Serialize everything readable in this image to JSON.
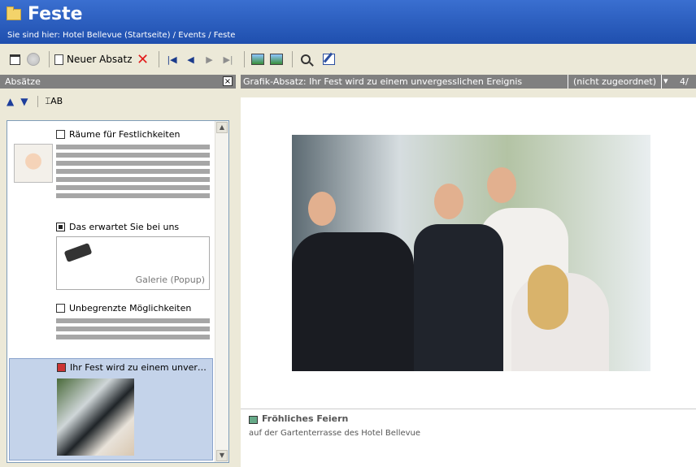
{
  "header": {
    "title": "Feste",
    "breadcrumb": "Sie sind hier: Hotel Bellevue (Startseite) / Events / Feste"
  },
  "toolbar": {
    "new_paragraph_label": "Neuer Absatz"
  },
  "left_panel": {
    "title": "Absätze",
    "close_label": "×",
    "ab_label": "AB",
    "items": [
      {
        "title": "Räume für Festlichkeiten",
        "type": "text"
      },
      {
        "title": "Das erwartet Sie bei uns",
        "type": "gallery",
        "gallery_label": "Galerie (Popup)"
      },
      {
        "title": "Unbegrenzte Möglichkeiten",
        "type": "text"
      },
      {
        "title": "Ihr Fest wird zu einem unver…",
        "type": "image",
        "selected": true
      }
    ]
  },
  "editor": {
    "title": "Grafik-Absatz: Ihr Fest wird zu einem unvergesslichen Ereignis",
    "assignment": "(nicht zugeordnet)",
    "page_indicator": "4/",
    "caption_title": "Fröhliches Feiern",
    "caption_subtitle": "auf der Gartenterrasse des Hotel Bellevue"
  },
  "colors": {
    "header_blue": "#2456b8",
    "panel_header_gray": "#808080",
    "selection": "#c4d3ea"
  }
}
